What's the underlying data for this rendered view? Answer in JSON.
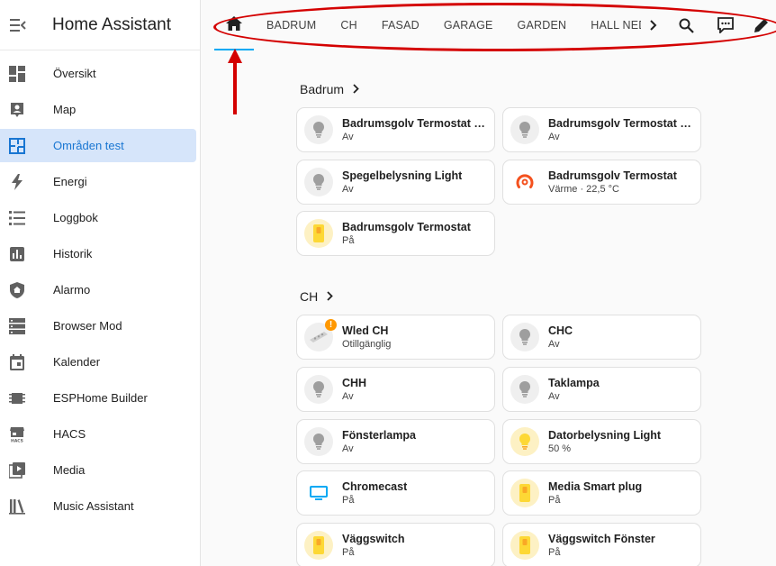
{
  "app": {
    "title": "Home Assistant"
  },
  "sidebar": {
    "items": [
      {
        "label": "Översikt",
        "icon": "dashboard-icon"
      },
      {
        "label": "Map",
        "icon": "map-person-icon"
      },
      {
        "label": "Områden test",
        "icon": "floorplan-icon",
        "active": true
      },
      {
        "label": "Energi",
        "icon": "lightning-icon"
      },
      {
        "label": "Loggbok",
        "icon": "list-icon"
      },
      {
        "label": "Historik",
        "icon": "chart-icon"
      },
      {
        "label": "Alarmo",
        "icon": "shield-home-icon"
      },
      {
        "label": "Browser Mod",
        "icon": "server-icon"
      },
      {
        "label": "Kalender",
        "icon": "calendar-icon"
      },
      {
        "label": "ESPHome Builder",
        "icon": "chip-icon"
      },
      {
        "label": "HACS",
        "icon": "hacs-icon"
      },
      {
        "label": "Media",
        "icon": "play-box-icon"
      },
      {
        "label": "Music Assistant",
        "icon": "library-icon"
      }
    ]
  },
  "toolbar": {
    "tabs": [
      "BADRUM",
      "CH",
      "FASAD",
      "GARAGE",
      "GARDEN",
      "HALL NEDERVÅNING"
    ],
    "accent": "#03a9f4",
    "annotation_color": "#d40000"
  },
  "sections": [
    {
      "title": "Badrum",
      "cards": [
        {
          "name": "Badrumsgolv Termostat Badrum",
          "state": "Av",
          "icon": "bulb-icon"
        },
        {
          "name": "Badrumsgolv Termostat Badrum",
          "state": "Av",
          "icon": "bulb-icon"
        },
        {
          "name": "Spegelbelysning Light",
          "state": "Av",
          "icon": "bulb-icon"
        },
        {
          "name": "Badrumsgolv Termostat",
          "state": "Värme · 22,5 °C",
          "icon": "thermostat-icon"
        },
        {
          "name": "Badrumsgolv Termostat",
          "state": "På",
          "icon": "switch-icon"
        }
      ]
    },
    {
      "title": "CH",
      "cards": [
        {
          "name": "Wled CH",
          "state": "Otillgänglig",
          "icon": "led-strip-icon",
          "badge": "!"
        },
        {
          "name": "CHC",
          "state": "Av",
          "icon": "bulb-icon"
        },
        {
          "name": "CHH",
          "state": "Av",
          "icon": "bulb-icon"
        },
        {
          "name": "Taklampa",
          "state": "Av",
          "icon": "bulb-icon"
        },
        {
          "name": "Fönsterlampa",
          "state": "Av",
          "icon": "bulb-icon"
        },
        {
          "name": "Datorbelysning Light",
          "state": "50 %",
          "icon": "bulb-on-icon"
        },
        {
          "name": "Chromecast",
          "state": "På",
          "icon": "tv-icon"
        },
        {
          "name": "Media Smart plug",
          "state": "På",
          "icon": "switch-icon"
        },
        {
          "name": "Väggswitch",
          "state": "På",
          "icon": "switch-icon"
        },
        {
          "name": "Väggswitch Fönster",
          "state": "På",
          "icon": "switch-icon"
        }
      ]
    }
  ]
}
